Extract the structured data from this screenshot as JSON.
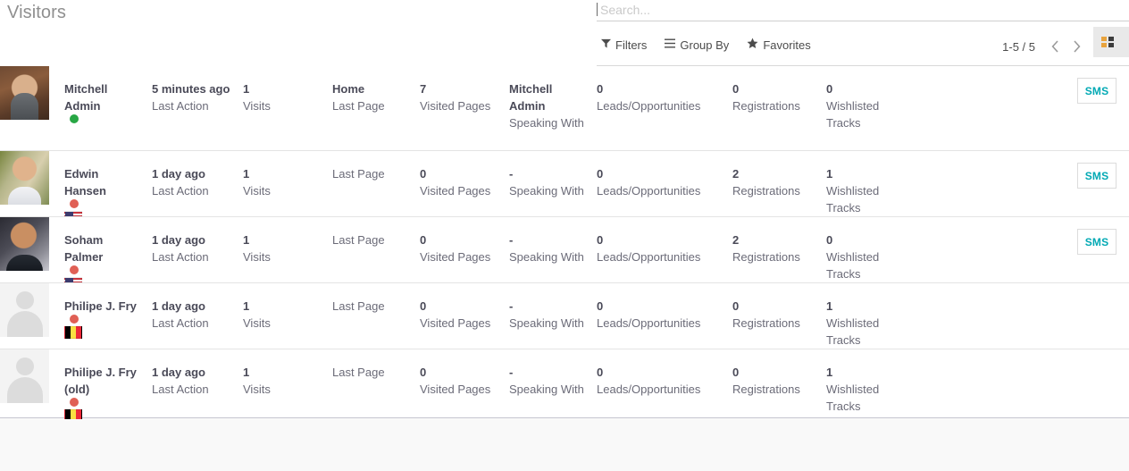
{
  "header": {
    "title": "Visitors"
  },
  "search": {
    "placeholder": "Search...",
    "value": ""
  },
  "toolbar": {
    "filters_label": "Filters",
    "group_by_label": "Group By",
    "favorites_label": "Favorites",
    "filters_icon": "funnel-icon",
    "group_by_icon": "hamburger-icon",
    "favorites_icon": "star-icon",
    "pager_text": "1-5 / 5",
    "prev_icon": "chevron-left-icon",
    "next_icon": "chevron-right-icon",
    "view_switcher_icon": "kanban-view-icon"
  },
  "labels": {
    "last_action": "Last Action",
    "visits": "Visits",
    "last_page": "Last Page",
    "visited_pages": "Visited Pages",
    "speaking_with": "Speaking With",
    "leads": "Leads/Opportunities",
    "registrations": "Registrations",
    "wishlisted": "Wishlisted Tracks",
    "sms": "SMS"
  },
  "colors": {
    "status_online": "#28a745",
    "status_offline": "#e06055",
    "sms_text": "#01a9b4",
    "title": "#8f8f8f"
  },
  "rows": [
    {
      "name": "Mitchell Admin",
      "status": "online",
      "avatar": "photo1",
      "flag": "",
      "last_action": "5 minutes ago",
      "visits": "1",
      "last_page": "Home",
      "visited_pages": "7",
      "speaking_with": "Mitchell Admin",
      "leads": "0",
      "registrations": "0",
      "wishlisted": "0",
      "has_sms": true
    },
    {
      "name": "Edwin Hansen",
      "status": "offline",
      "avatar": "photo2",
      "flag": "us",
      "last_action": "1 day ago",
      "visits": "1",
      "last_page": "",
      "visited_pages": "0",
      "speaking_with": "-",
      "leads": "0",
      "registrations": "2",
      "wishlisted": "1",
      "has_sms": true
    },
    {
      "name": "Soham Palmer",
      "status": "offline",
      "avatar": "photo3",
      "flag": "us",
      "last_action": "1 day ago",
      "visits": "1",
      "last_page": "",
      "visited_pages": "0",
      "speaking_with": "-",
      "leads": "0",
      "registrations": "2",
      "wishlisted": "0",
      "has_sms": true
    },
    {
      "name": "Philipe J. Fry",
      "status": "offline",
      "avatar": "placeholder",
      "flag": "be",
      "last_action": "1 day ago",
      "visits": "1",
      "last_page": "",
      "visited_pages": "0",
      "speaking_with": "-",
      "leads": "0",
      "registrations": "0",
      "wishlisted": "1",
      "has_sms": false
    },
    {
      "name": "Philipe J. Fry (old)",
      "status": "offline",
      "avatar": "placeholder",
      "flag": "be",
      "last_action": "1 day ago",
      "visits": "1",
      "last_page": "",
      "visited_pages": "0",
      "speaking_with": "-",
      "leads": "0",
      "registrations": "0",
      "wishlisted": "1",
      "has_sms": false
    }
  ]
}
